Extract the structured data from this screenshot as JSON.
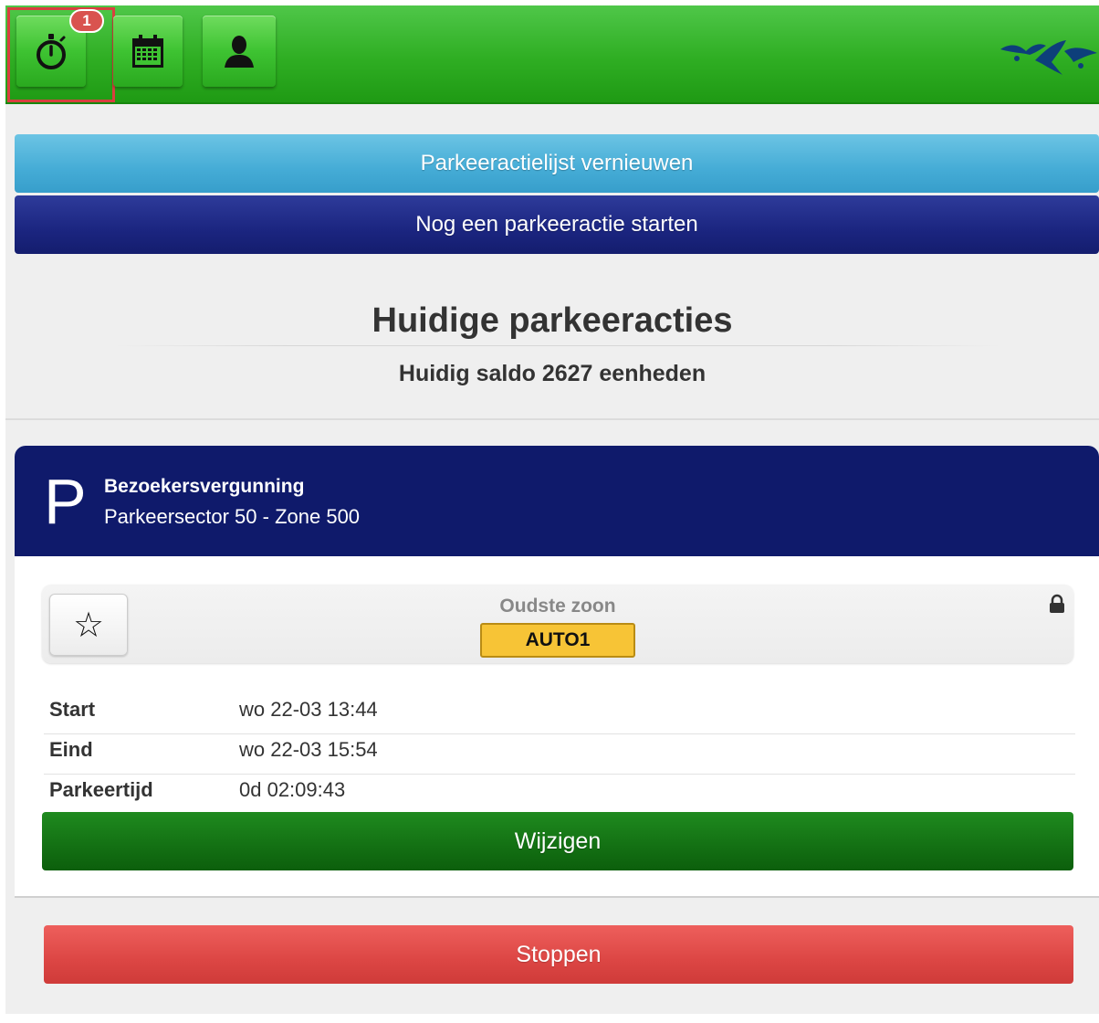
{
  "nav": {
    "timer_badge": "1",
    "timer_icon": "stopwatch-icon",
    "calendar_icon": "calendar-icon",
    "profile_icon": "person-icon",
    "highlight_color": "#d9403f"
  },
  "actions": {
    "refresh_label": "Parkeeractielijst vernieuwen",
    "new_label": "Nog een parkeeractie starten"
  },
  "summary": {
    "title": "Huidige parkeeracties",
    "balance": "Huidig saldo 2627 eenheden"
  },
  "session": {
    "p_symbol": "P",
    "permit_name": "Bezoekersvergunning",
    "zone": "Parkeersector 50 - Zone 500",
    "vehicle_label": "Oudste zoon",
    "plate": "AUTO1",
    "favorite_icon": "star-icon",
    "lock_icon": "lock-icon",
    "details": [
      {
        "label": "Start",
        "value": "wo 22-03 13:44"
      },
      {
        "label": "Eind",
        "value": "wo 22-03 15:54"
      },
      {
        "label": "Parkeertijd",
        "value": "0d 02:09:43"
      }
    ],
    "change_label": "Wijzigen",
    "stop_label": "Stoppen"
  },
  "colors": {
    "header_green": "#2fae23",
    "refresh_blue": "#45acd6",
    "navy": "#0f1a6b",
    "change_green": "#137013",
    "stop_red": "#dc4644",
    "plate_yellow": "#f7c436"
  }
}
